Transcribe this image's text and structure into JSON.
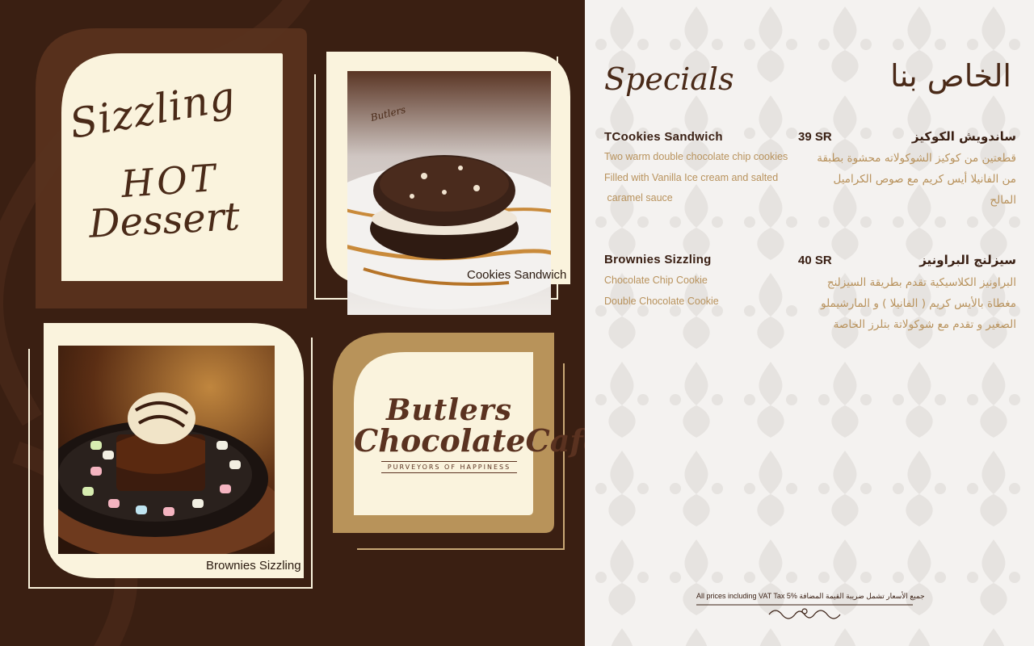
{
  "left_panel": {
    "promo": {
      "line1": "Sizzling",
      "line2": "HOT",
      "line3": "Dessert"
    },
    "photos": [
      {
        "caption": "Cookies Sandwich"
      },
      {
        "caption": "Brownies Sizzling"
      }
    ],
    "logo": {
      "line1": "Butlers",
      "line2": "ChocolateCafé",
      "tagline": "PURVEYORS OF HAPPINESS"
    }
  },
  "menu": {
    "title_en": "Specials",
    "title_ar": "الخاص بنا",
    "items": [
      {
        "name": "TCookies Sandwich",
        "price": "39 SR",
        "name_ar": "ساندويش الكوكيز",
        "desc_lines": [
          "Two warm double chocolate chip cookies",
          "Filled with Vanilla  Ice cream and salted",
          " caramel sauce"
        ],
        "desc_ar": "قطعتين من كوكيز الشوكولاته محشوة بطبقة من الفانيلا أيس كريم مع صوص الكراميل المالح"
      },
      {
        "name": "Brownies Sizzling",
        "price": "40 SR",
        "name_ar": "سيزلنج البراونيز",
        "desc_lines": [
          "Chocolate Chip Cookie",
          "Double Chocolate Cookie"
        ],
        "desc_ar": "البراونيز الكلاسيكية تقدم بطريقة السيزلنج مغطاة بالأيس كريم ( الفانيلا ) و المارشيملو الصغير و تقدم مع شوكولاتة بتلرز الخاصة"
      }
    ],
    "footer": "All prices including VAT Tax   5%   جميع الأسعار تشمل ضريبة القيمة المضافة"
  },
  "colors": {
    "brown_dark": "#3a1f12",
    "cream": "#faf3dd",
    "gold": "#b8925c",
    "text_brown": "#4a2a18"
  }
}
